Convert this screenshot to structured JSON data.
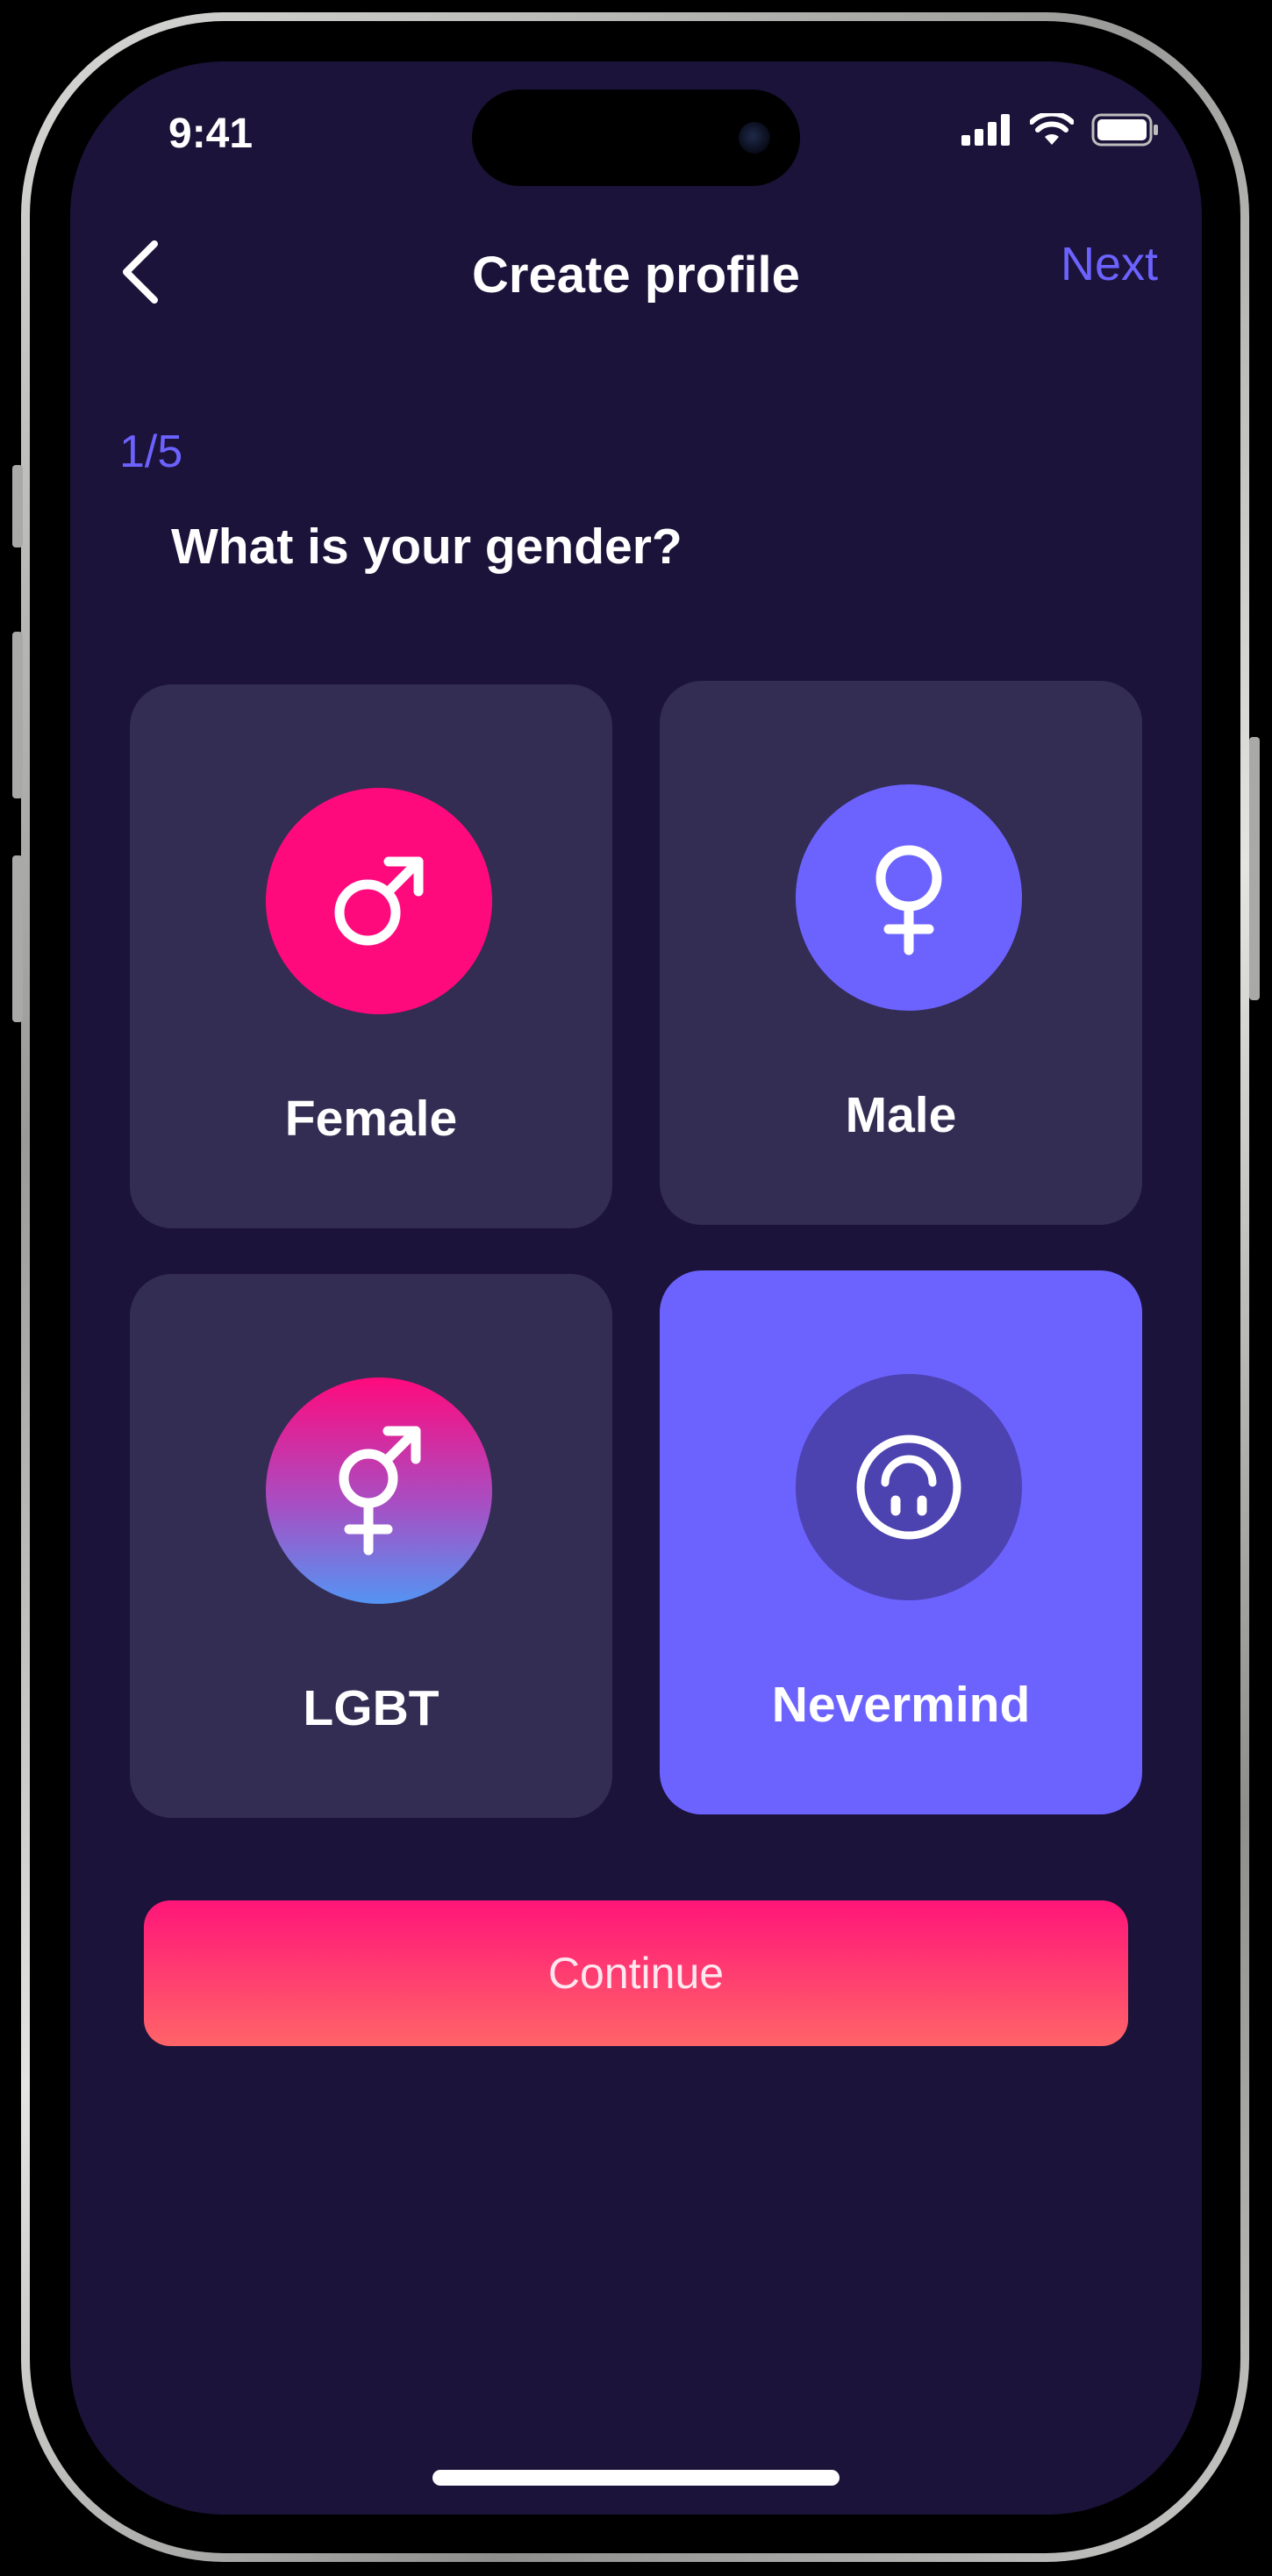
{
  "status_bar": {
    "time": "9:41"
  },
  "header": {
    "title": "Create profile",
    "next_label": "Next"
  },
  "progress": {
    "step_text": "1/5"
  },
  "question": "What is your gender?",
  "options": [
    {
      "label": "Female",
      "icon": "mars-icon",
      "selected": false
    },
    {
      "label": "Male",
      "icon": "venus-icon",
      "selected": false
    },
    {
      "label": "LGBT",
      "icon": "transgender-icon",
      "selected": false
    },
    {
      "label": "Nevermind",
      "icon": "upside-down-smile-icon",
      "selected": true
    }
  ],
  "continue_label": "Continue",
  "colors": {
    "background": "#1b1339",
    "card": "#332c53",
    "accent": "#6c63ff",
    "pink": "#ff0a7d",
    "button_gradient_top": "#ff1579",
    "button_gradient_bottom": "#ff6468"
  }
}
